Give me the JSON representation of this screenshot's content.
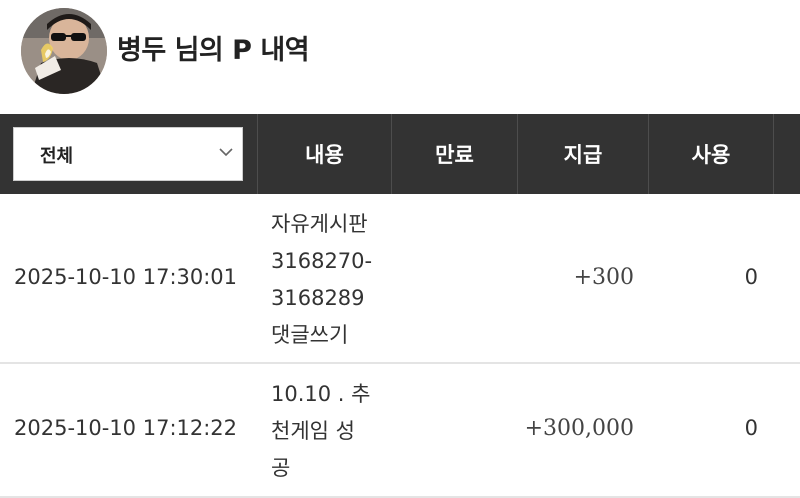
{
  "header": {
    "title": "병두 님의 P 내역"
  },
  "table": {
    "filter": {
      "selected": "전체"
    },
    "columns": {
      "content": "내용",
      "expiry": "만료",
      "grant": "지급",
      "used": "사용"
    },
    "rows": [
      {
        "datetime": "2025-10-10 17:30:01",
        "content_lines": [
          "자유게시판",
          "3168270-",
          "3168289",
          "댓글쓰기"
        ],
        "expiry": "",
        "grant": "+300",
        "used": "0"
      },
      {
        "datetime": "2025-10-10 17:12:22",
        "content_lines": [
          "10.10 . 추",
          "천게임 성",
          "공"
        ],
        "expiry": "",
        "grant": "+300,000",
        "used": "0"
      }
    ]
  },
  "colors": {
    "header_bg": "#333333",
    "header_text": "#ffffff",
    "row_divider": "#e4e4e4"
  },
  "icons": {
    "avatar": "profile-avatar-image",
    "dropdown": "chevron-down-icon"
  }
}
